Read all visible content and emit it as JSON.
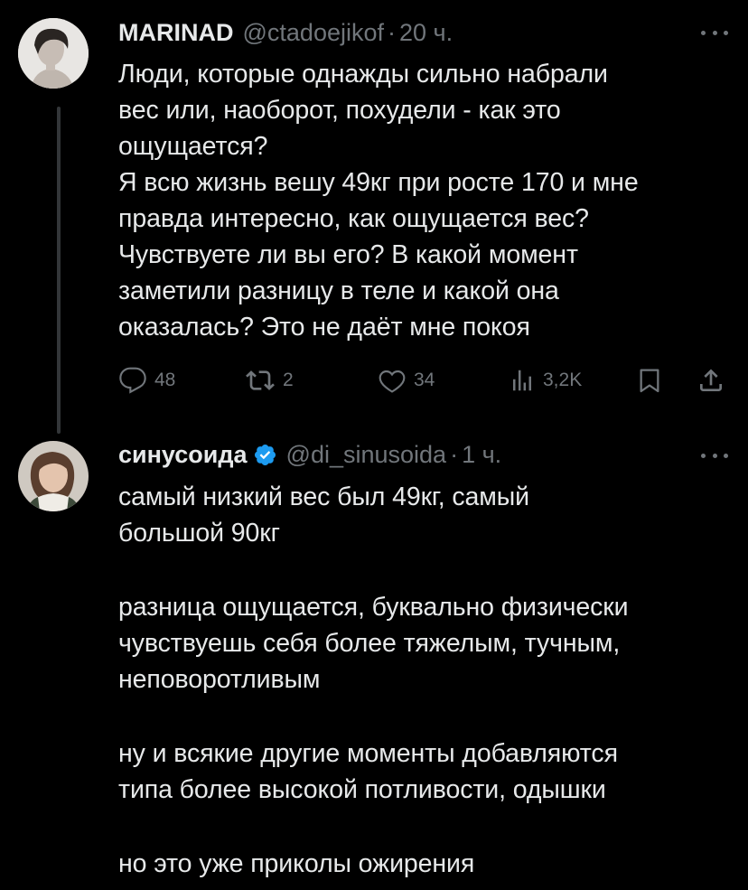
{
  "tweet1": {
    "display_name": "MARINAD",
    "handle": "@ctadoejikof",
    "separator": "·",
    "time": "20 ч.",
    "lines": [
      "Люди, которые однажды сильно набрали",
      "вес или, наоборот, похудели - как это",
      "ощущается?",
      "Я всю жизнь вешу 49кг при росте 170 и мне",
      "правда интересно, как ощущается вес?",
      "Чувствуете ли вы его? В какой момент",
      "заметили разницу в теле и какой она",
      "оказалась? Это не даёт мне покоя"
    ],
    "stats": {
      "replies": "48",
      "retweets": "2",
      "likes": "34",
      "views": "3,2K"
    }
  },
  "tweet2": {
    "display_name": "синусоида",
    "handle": "@di_sinusoida",
    "separator": "·",
    "time": "1 ч.",
    "lines": [
      "самый низкий вес был 49кг, самый",
      "большой 90кг",
      "",
      "разница ощущается, буквально физически",
      "чувствуешь себя более тяжелым, тучным,",
      "неповоротливым",
      "",
      "ну и всякие другие моменты добавляются",
      "типа более высокой потливости, одышки",
      "",
      "но это уже приколы ожирения"
    ]
  },
  "colors": {
    "background": "#000000",
    "text": "#e7e9ea",
    "secondary": "#71767b",
    "verified": "#1d9bf0",
    "thread_line": "#333639"
  },
  "icons": [
    "reply-icon",
    "retweet-icon",
    "like-icon",
    "views-icon",
    "bookmark-icon",
    "share-icon",
    "more-icon",
    "verified-icon"
  ]
}
